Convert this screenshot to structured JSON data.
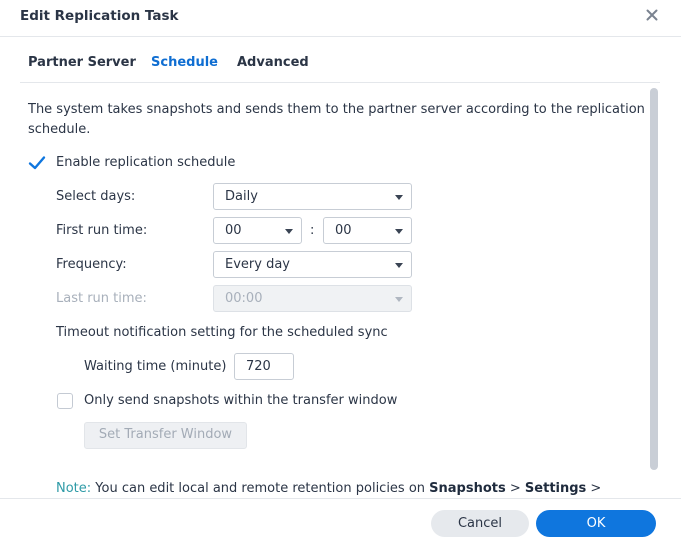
{
  "window": {
    "title": "Edit Replication Task",
    "close_icon": "close-x-icon"
  },
  "tabs": [
    {
      "label": "Partner Server",
      "active": false
    },
    {
      "label": "Schedule",
      "active": true
    },
    {
      "label": "Advanced",
      "active": false
    }
  ],
  "schedule": {
    "description": "The system takes snapshots and sends them to the partner server according to the replication schedule.",
    "enable_schedule": {
      "label": "Enable replication schedule",
      "checked": true
    },
    "select_days": {
      "label": "Select days:",
      "value": "Daily"
    },
    "first_run_time": {
      "label": "First run time:",
      "hour": "00",
      "separator": ":",
      "minute": "00"
    },
    "frequency": {
      "label": "Frequency:",
      "value": "Every day"
    },
    "last_run_time": {
      "label": "Last run time:",
      "value": "00:00",
      "disabled": true
    },
    "timeout_heading": "Timeout notification setting for the scheduled sync",
    "waiting_time": {
      "label": "Waiting time (minute)",
      "value": "720"
    },
    "transfer_window": {
      "label": "Only send snapshots within the transfer window",
      "checked": false
    },
    "set_transfer_window_button": "Set Transfer Window",
    "note": {
      "prefix": "Note:",
      "text": " You can edit local and remote retention policies on ",
      "bold1": "Snapshots",
      "sep": " > ",
      "bold2": "Settings",
      "tail": " >"
    }
  },
  "footer": {
    "cancel_label": "Cancel",
    "ok_label": "OK"
  },
  "colors": {
    "accent": "#0f76de",
    "active_tab": "#0f6ed2",
    "note_label": "#2f9ba7"
  }
}
